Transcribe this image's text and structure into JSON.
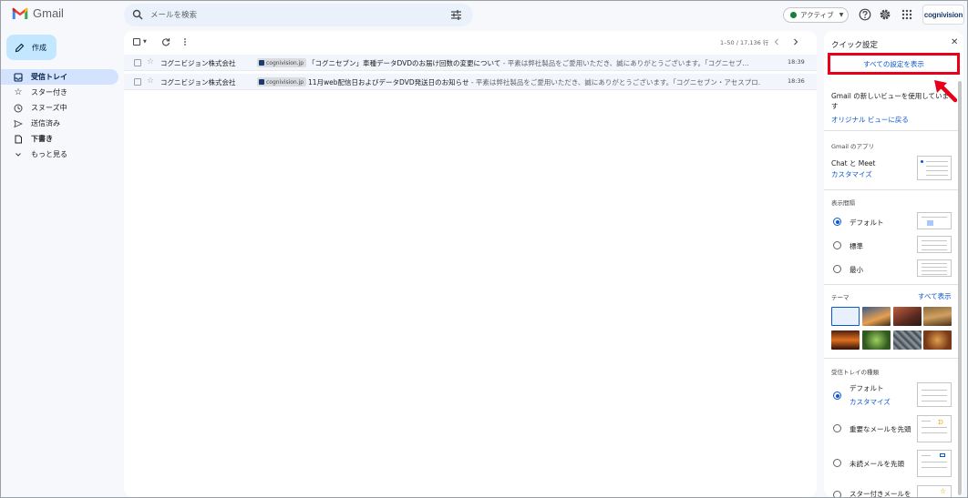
{
  "app": {
    "name": "Gmail"
  },
  "search": {
    "placeholder": "メールを検索"
  },
  "status": {
    "label": "アクティブ"
  },
  "account": {
    "logo_text": "cognivision"
  },
  "compose": {
    "label": "作成"
  },
  "nav": [
    {
      "label": "受信トレイ",
      "icon": "inbox-icon",
      "active": true
    },
    {
      "label": "スター付き",
      "icon": "star-icon"
    },
    {
      "label": "スヌーズ中",
      "icon": "clock-icon"
    },
    {
      "label": "送信済み",
      "icon": "send-icon"
    },
    {
      "label": "下書き",
      "icon": "file-icon"
    },
    {
      "label": "もっと見る",
      "icon": "chevron-down-icon"
    }
  ],
  "toolbar": {
    "pager": "1–50 / 17,136 行"
  },
  "emails": [
    {
      "sender": "コグニビジョン株式会社",
      "label": "cognivision.jp",
      "subject": "「コグニセブン」車種データDVDのお届け回数の変更について",
      "snippet": " - 平素は弊社製品をご愛用いただき、誠にありがとうございます。「コグニセブ…",
      "date": "18:39"
    },
    {
      "sender": "コグニビジョン株式会社",
      "label": "cognivision.jp",
      "subject": "11月web配信日およびデータDVD発送日のお知らせ",
      "snippet": " - 平素は弊社製品をご愛用いただき、誠にありがとうございます。「コグニセブン・アセスプロ…",
      "date": "18:36"
    }
  ],
  "quick_settings": {
    "title": "クイック設定",
    "all_settings": "すべての設定を表示",
    "new_view_text": "Gmail の新しいビューを使用しています",
    "revert_link": "オリジナル ビューに戻る",
    "apps_heading": "Gmail のアプリ",
    "chat_meet": "Chat と Meet",
    "customize": "カスタマイズ",
    "density_heading": "表示間隔",
    "density": [
      "デフォルト",
      "標準",
      "最小"
    ],
    "theme_heading": "テーマ",
    "theme_link": "すべて表示",
    "inbox_type_heading": "受信トレイの種類",
    "inbox_default": "デフォルト",
    "inbox_customize": "カスタマイズ",
    "inbox_important": "重要なメールを先頭",
    "inbox_unread": "未読メールを先頭",
    "inbox_starred": "スター付きメールを"
  },
  "colors": {
    "accent": "#0b57d0",
    "highlight_box": "#e8001a",
    "compose_bg": "#c2e7ff",
    "active_nav": "#d3e3fd"
  }
}
